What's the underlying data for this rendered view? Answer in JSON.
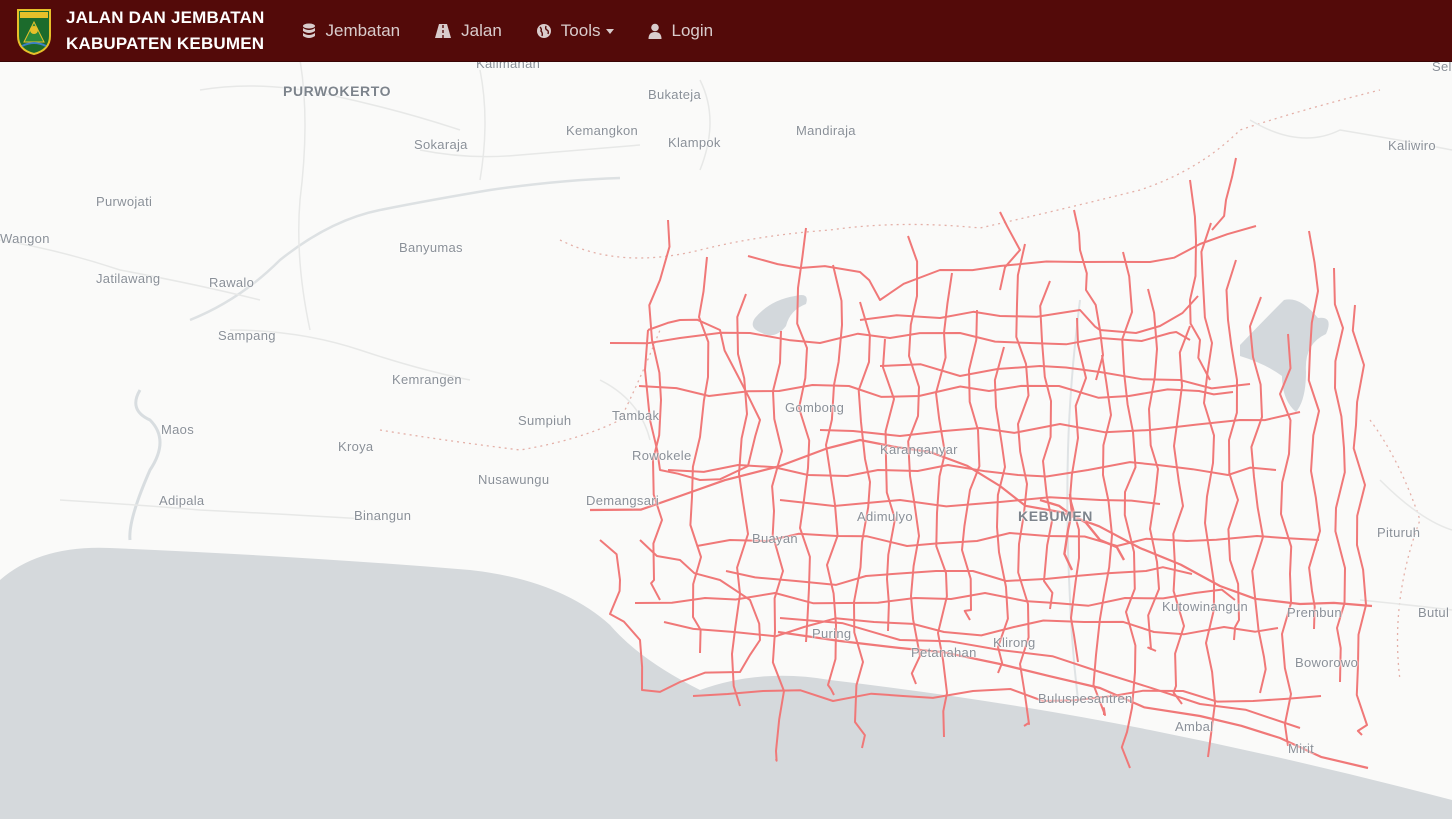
{
  "header": {
    "title_line1": "JALAN DAN JEMBATAN",
    "title_line2": "KABUPATEN KEBUMEN"
  },
  "nav": [
    {
      "label": "Jembatan",
      "icon": "database-icon"
    },
    {
      "label": "Jalan",
      "icon": "road-icon"
    },
    {
      "label": "Tools",
      "icon": "globe-icon",
      "has_dropdown": true
    },
    {
      "label": "Login",
      "icon": "user-icon"
    }
  ],
  "colors": {
    "navbar": "#530a09",
    "road": "#f07878",
    "sea": "#d5d9dc",
    "land": "#fafaf9",
    "lake": "#d3d8dc"
  },
  "map": {
    "places": [
      {
        "label": "Kalimanah"
      },
      {
        "label": "PURWOKERTO",
        "type": "city"
      },
      {
        "label": "Bukateja"
      },
      {
        "label": "Sel"
      },
      {
        "label": "Kemangkon"
      },
      {
        "label": "Mandiraja"
      },
      {
        "label": "Sokaraja"
      },
      {
        "label": "Klampok"
      },
      {
        "label": "Kaliwiro"
      },
      {
        "label": "Purwojati"
      },
      {
        "label": "Wangon"
      },
      {
        "label": "Banyumas"
      },
      {
        "label": "Jatilawang"
      },
      {
        "label": "Rawalo"
      },
      {
        "label": "Sampang"
      },
      {
        "label": "Kemrangen"
      },
      {
        "label": "Maos"
      },
      {
        "label": "Sumpiuh"
      },
      {
        "label": "Tambak"
      },
      {
        "label": "Gombong"
      },
      {
        "label": "Kroya"
      },
      {
        "label": "Rowokele"
      },
      {
        "label": "Karanganyar"
      },
      {
        "label": "Nusawungu"
      },
      {
        "label": "Adipala"
      },
      {
        "label": "Demangsari"
      },
      {
        "label": "Binangun"
      },
      {
        "label": "Adimulyo"
      },
      {
        "label": "KEBUMEN",
        "type": "city"
      },
      {
        "label": "Pituruh"
      },
      {
        "label": "Buayan"
      },
      {
        "label": "Kutowinangun"
      },
      {
        "label": "Prembun"
      },
      {
        "label": "Butul"
      },
      {
        "label": "Puring"
      },
      {
        "label": "Klirong"
      },
      {
        "label": "Petanahan"
      },
      {
        "label": "Boworowo"
      },
      {
        "label": "Buluspesantren"
      },
      {
        "label": "Ambal"
      },
      {
        "label": "Mirit"
      }
    ]
  }
}
